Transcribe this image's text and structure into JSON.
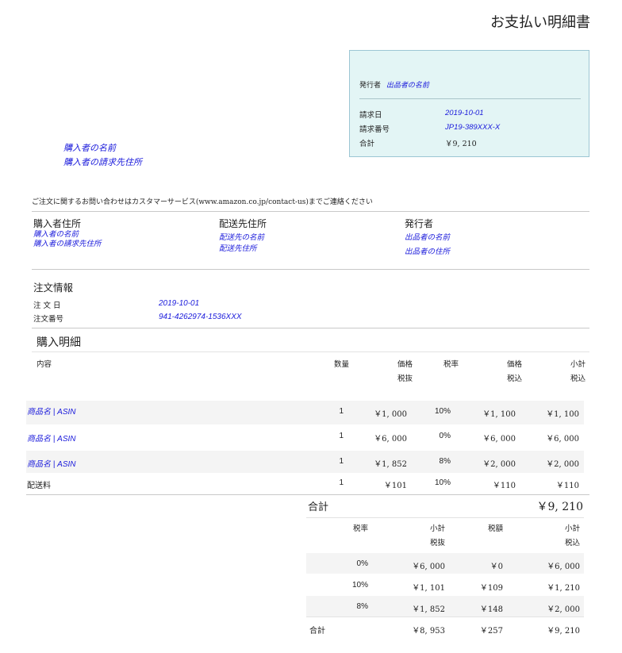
{
  "title": "お支払い明細書",
  "infobox": {
    "issuer_label": "発行者",
    "issuer_value": "出品者の名前",
    "invoice_date_label": "請求日",
    "invoice_date": "2019-10-01",
    "invoice_no_label": "請求番号",
    "invoice_no": "JP19-389XXX-X",
    "total_label": "合計",
    "total": "￥9, 210"
  },
  "buyer_block": {
    "name": "購入者の名前",
    "address": "購入者の請求先住所"
  },
  "contact_note": "ご注文に関するお問い合わせはカスタマーサービス(www.amazon.co.jp/contact-us)までご連絡ください",
  "addresses": {
    "buyer": {
      "heading": "購入者住所",
      "line1": "購入者の名前",
      "line2": "購入者の請求先住所"
    },
    "shipping": {
      "heading": "配送先住所",
      "line1": "配送先の名前",
      "line2": "配送先住所"
    },
    "issuer": {
      "heading": "発行者",
      "line1": "出品者の名前",
      "line2": "出品者の住所"
    }
  },
  "order": {
    "heading": "注文情報",
    "date_label": "注 文 日",
    "date": "2019-10-01",
    "number_label": "注文番号",
    "number": "941-4262974-1536XXX"
  },
  "items": {
    "heading": "購入明細",
    "headers": {
      "content": "内容",
      "qty": "数量",
      "price_ex_1": "価格",
      "price_ex_2": "税抜",
      "rate": "税率",
      "price_in_1": "価格",
      "price_in_2": "税込",
      "subtotal_1": "小計",
      "subtotal_2": "税込"
    },
    "rows": [
      {
        "name": "商品名 | ASIN",
        "qty": "1",
        "price_ex": "￥1, 000",
        "rate": "10%",
        "price_in": "￥1, 100",
        "subtotal": "￥1, 100"
      },
      {
        "name": "商品名 | ASIN",
        "qty": "1",
        "price_ex": "￥6, 000",
        "rate": "0%",
        "price_in": "￥6, 000",
        "subtotal": "￥6, 000"
      },
      {
        "name": "商品名 | ASIN",
        "qty": "1",
        "price_ex": "￥1, 852",
        "rate": "8%",
        "price_in": "￥2, 000",
        "subtotal": "￥2, 000"
      },
      {
        "name": "配送料",
        "qty": "1",
        "price_ex": "￥101",
        "rate": "10%",
        "price_in": "￥110",
        "subtotal": "￥110"
      }
    ]
  },
  "summary": {
    "heading": "合計",
    "total": "￥9, 210",
    "headers": {
      "rate": "税率",
      "sub_ex_1": "小計",
      "sub_ex_2": "税抜",
      "tax": "税額",
      "sub_in_1": "小計",
      "sub_in_2": "税込"
    },
    "rows": [
      {
        "rate": "0%",
        "sub_ex": "￥6, 000",
        "tax": "￥0",
        "sub_in": "￥6, 000"
      },
      {
        "rate": "10%",
        "sub_ex": "￥1, 101",
        "tax": "￥109",
        "sub_in": "￥1, 210"
      },
      {
        "rate": "8%",
        "sub_ex": "￥1, 852",
        "tax": "￥148",
        "sub_in": "￥2, 000"
      }
    ],
    "total_row": {
      "label": "合計",
      "sub_ex": "￥8, 953",
      "tax": "￥257",
      "sub_in": "￥9, 210"
    }
  }
}
